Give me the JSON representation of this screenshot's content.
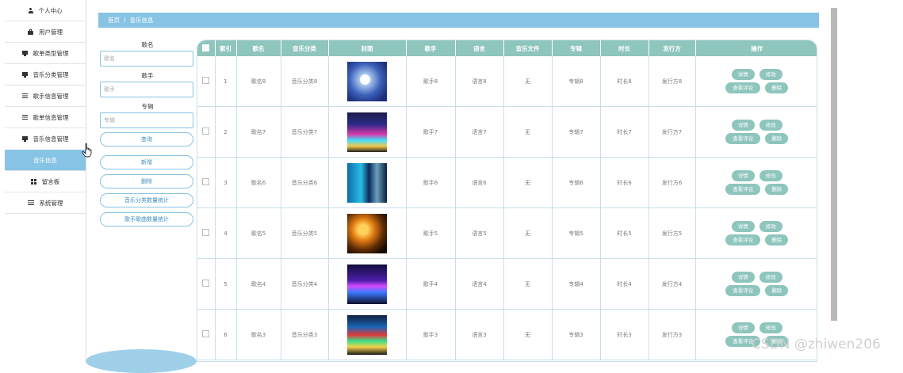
{
  "sidebar": {
    "items": [
      {
        "label": "个人中心",
        "icon": "user-icon"
      },
      {
        "label": "用户管理",
        "icon": "briefcase-icon"
      },
      {
        "label": "歌单类型管理",
        "icon": "monitor-icon"
      },
      {
        "label": "音乐分类管理",
        "icon": "monitor-icon"
      },
      {
        "label": "歌手信息管理",
        "icon": "list-icon"
      },
      {
        "label": "歌单信息管理",
        "icon": "list-icon"
      },
      {
        "label": "音乐信息管理",
        "icon": "monitor-icon"
      },
      {
        "label": "音乐信息",
        "icon": ""
      },
      {
        "label": "留言板",
        "icon": "grid-icon"
      },
      {
        "label": "系统管理",
        "icon": "sliders-icon"
      }
    ]
  },
  "breadcrumb": {
    "home": "首页",
    "separator": "/",
    "current": "音乐信息"
  },
  "search": {
    "song_label": "歌名",
    "song_placeholder": "歌名",
    "singer_label": "歌手",
    "singer_placeholder": "歌手",
    "album_label": "专辑",
    "album_placeholder": "专辑",
    "query_btn": "查询",
    "add_btn": "新增",
    "delete_btn": "删除",
    "stat1_btn": "音乐分类数量统计",
    "stat2_btn": "歌手歌曲数量统计"
  },
  "table": {
    "headers": [
      "索引",
      "歌名",
      "音乐分类",
      "封面",
      "歌手",
      "语言",
      "音乐文件",
      "专辑",
      "时长",
      "发行方",
      "操作"
    ],
    "rows": [
      {
        "index": "1",
        "name": "歌名8",
        "category": "音乐分类8",
        "singer": "歌手8",
        "language": "语言8",
        "file": "无",
        "album": "专辑8",
        "duration": "时长8",
        "publisher": "发行方8"
      },
      {
        "index": "2",
        "name": "歌名7",
        "category": "音乐分类7",
        "singer": "歌手7",
        "language": "语言7",
        "file": "无",
        "album": "专辑7",
        "duration": "时长7",
        "publisher": "发行方7"
      },
      {
        "index": "3",
        "name": "歌名6",
        "category": "音乐分类6",
        "singer": "歌手6",
        "language": "语言6",
        "file": "无",
        "album": "专辑6",
        "duration": "时长6",
        "publisher": "发行方6"
      },
      {
        "index": "4",
        "name": "歌名5",
        "category": "音乐分类5",
        "singer": "歌手5",
        "language": "语言5",
        "file": "无",
        "album": "专辑5",
        "duration": "时长5",
        "publisher": "发行方5"
      },
      {
        "index": "5",
        "name": "歌名4",
        "category": "音乐分类4",
        "singer": "歌手4",
        "language": "语言4",
        "file": "无",
        "album": "专辑4",
        "duration": "时长4",
        "publisher": "发行方4"
      },
      {
        "index": "6",
        "name": "歌名3",
        "category": "音乐分类3",
        "singer": "歌手3",
        "language": "语言3",
        "file": "无",
        "album": "专辑3",
        "duration": "时长3",
        "publisher": "发行方3"
      }
    ],
    "actions": {
      "detail": "详情",
      "edit": "修改",
      "comments": "查看评论",
      "delete": "删除"
    }
  },
  "watermark": "CSDN @zhiwen206",
  "colors": {
    "accent": "#87c3e4",
    "table_header": "#8ec5bd",
    "button_fill": "#8ec5bd"
  }
}
